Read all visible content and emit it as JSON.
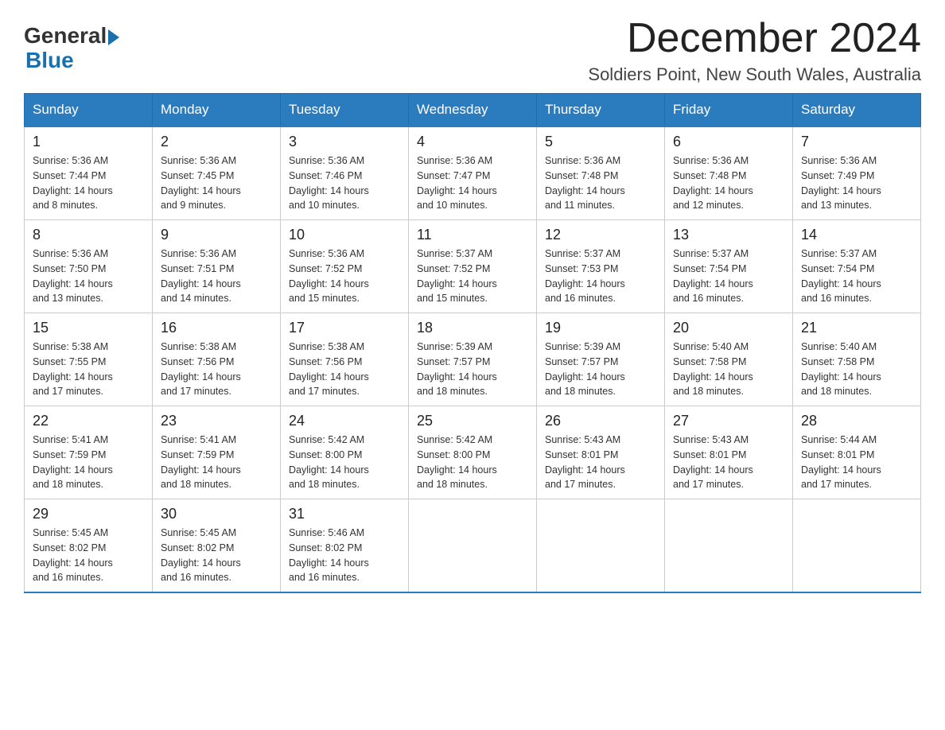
{
  "header": {
    "logo_general": "General",
    "logo_blue": "Blue",
    "month_title": "December 2024",
    "location": "Soldiers Point, New South Wales, Australia"
  },
  "weekdays": [
    "Sunday",
    "Monday",
    "Tuesday",
    "Wednesday",
    "Thursday",
    "Friday",
    "Saturday"
  ],
  "weeks": [
    [
      {
        "day": "1",
        "sunrise": "5:36 AM",
        "sunset": "7:44 PM",
        "daylight": "14 hours and 8 minutes."
      },
      {
        "day": "2",
        "sunrise": "5:36 AM",
        "sunset": "7:45 PM",
        "daylight": "14 hours and 9 minutes."
      },
      {
        "day": "3",
        "sunrise": "5:36 AM",
        "sunset": "7:46 PM",
        "daylight": "14 hours and 10 minutes."
      },
      {
        "day": "4",
        "sunrise": "5:36 AM",
        "sunset": "7:47 PM",
        "daylight": "14 hours and 10 minutes."
      },
      {
        "day": "5",
        "sunrise": "5:36 AM",
        "sunset": "7:48 PM",
        "daylight": "14 hours and 11 minutes."
      },
      {
        "day": "6",
        "sunrise": "5:36 AM",
        "sunset": "7:48 PM",
        "daylight": "14 hours and 12 minutes."
      },
      {
        "day": "7",
        "sunrise": "5:36 AM",
        "sunset": "7:49 PM",
        "daylight": "14 hours and 13 minutes."
      }
    ],
    [
      {
        "day": "8",
        "sunrise": "5:36 AM",
        "sunset": "7:50 PM",
        "daylight": "14 hours and 13 minutes."
      },
      {
        "day": "9",
        "sunrise": "5:36 AM",
        "sunset": "7:51 PM",
        "daylight": "14 hours and 14 minutes."
      },
      {
        "day": "10",
        "sunrise": "5:36 AM",
        "sunset": "7:52 PM",
        "daylight": "14 hours and 15 minutes."
      },
      {
        "day": "11",
        "sunrise": "5:37 AM",
        "sunset": "7:52 PM",
        "daylight": "14 hours and 15 minutes."
      },
      {
        "day": "12",
        "sunrise": "5:37 AM",
        "sunset": "7:53 PM",
        "daylight": "14 hours and 16 minutes."
      },
      {
        "day": "13",
        "sunrise": "5:37 AM",
        "sunset": "7:54 PM",
        "daylight": "14 hours and 16 minutes."
      },
      {
        "day": "14",
        "sunrise": "5:37 AM",
        "sunset": "7:54 PM",
        "daylight": "14 hours and 16 minutes."
      }
    ],
    [
      {
        "day": "15",
        "sunrise": "5:38 AM",
        "sunset": "7:55 PM",
        "daylight": "14 hours and 17 minutes."
      },
      {
        "day": "16",
        "sunrise": "5:38 AM",
        "sunset": "7:56 PM",
        "daylight": "14 hours and 17 minutes."
      },
      {
        "day": "17",
        "sunrise": "5:38 AM",
        "sunset": "7:56 PM",
        "daylight": "14 hours and 17 minutes."
      },
      {
        "day": "18",
        "sunrise": "5:39 AM",
        "sunset": "7:57 PM",
        "daylight": "14 hours and 18 minutes."
      },
      {
        "day": "19",
        "sunrise": "5:39 AM",
        "sunset": "7:57 PM",
        "daylight": "14 hours and 18 minutes."
      },
      {
        "day": "20",
        "sunrise": "5:40 AM",
        "sunset": "7:58 PM",
        "daylight": "14 hours and 18 minutes."
      },
      {
        "day": "21",
        "sunrise": "5:40 AM",
        "sunset": "7:58 PM",
        "daylight": "14 hours and 18 minutes."
      }
    ],
    [
      {
        "day": "22",
        "sunrise": "5:41 AM",
        "sunset": "7:59 PM",
        "daylight": "14 hours and 18 minutes."
      },
      {
        "day": "23",
        "sunrise": "5:41 AM",
        "sunset": "7:59 PM",
        "daylight": "14 hours and 18 minutes."
      },
      {
        "day": "24",
        "sunrise": "5:42 AM",
        "sunset": "8:00 PM",
        "daylight": "14 hours and 18 minutes."
      },
      {
        "day": "25",
        "sunrise": "5:42 AM",
        "sunset": "8:00 PM",
        "daylight": "14 hours and 18 minutes."
      },
      {
        "day": "26",
        "sunrise": "5:43 AM",
        "sunset": "8:01 PM",
        "daylight": "14 hours and 17 minutes."
      },
      {
        "day": "27",
        "sunrise": "5:43 AM",
        "sunset": "8:01 PM",
        "daylight": "14 hours and 17 minutes."
      },
      {
        "day": "28",
        "sunrise": "5:44 AM",
        "sunset": "8:01 PM",
        "daylight": "14 hours and 17 minutes."
      }
    ],
    [
      {
        "day": "29",
        "sunrise": "5:45 AM",
        "sunset": "8:02 PM",
        "daylight": "14 hours and 16 minutes."
      },
      {
        "day": "30",
        "sunrise": "5:45 AM",
        "sunset": "8:02 PM",
        "daylight": "14 hours and 16 minutes."
      },
      {
        "day": "31",
        "sunrise": "5:46 AM",
        "sunset": "8:02 PM",
        "daylight": "14 hours and 16 minutes."
      },
      null,
      null,
      null,
      null
    ]
  ]
}
